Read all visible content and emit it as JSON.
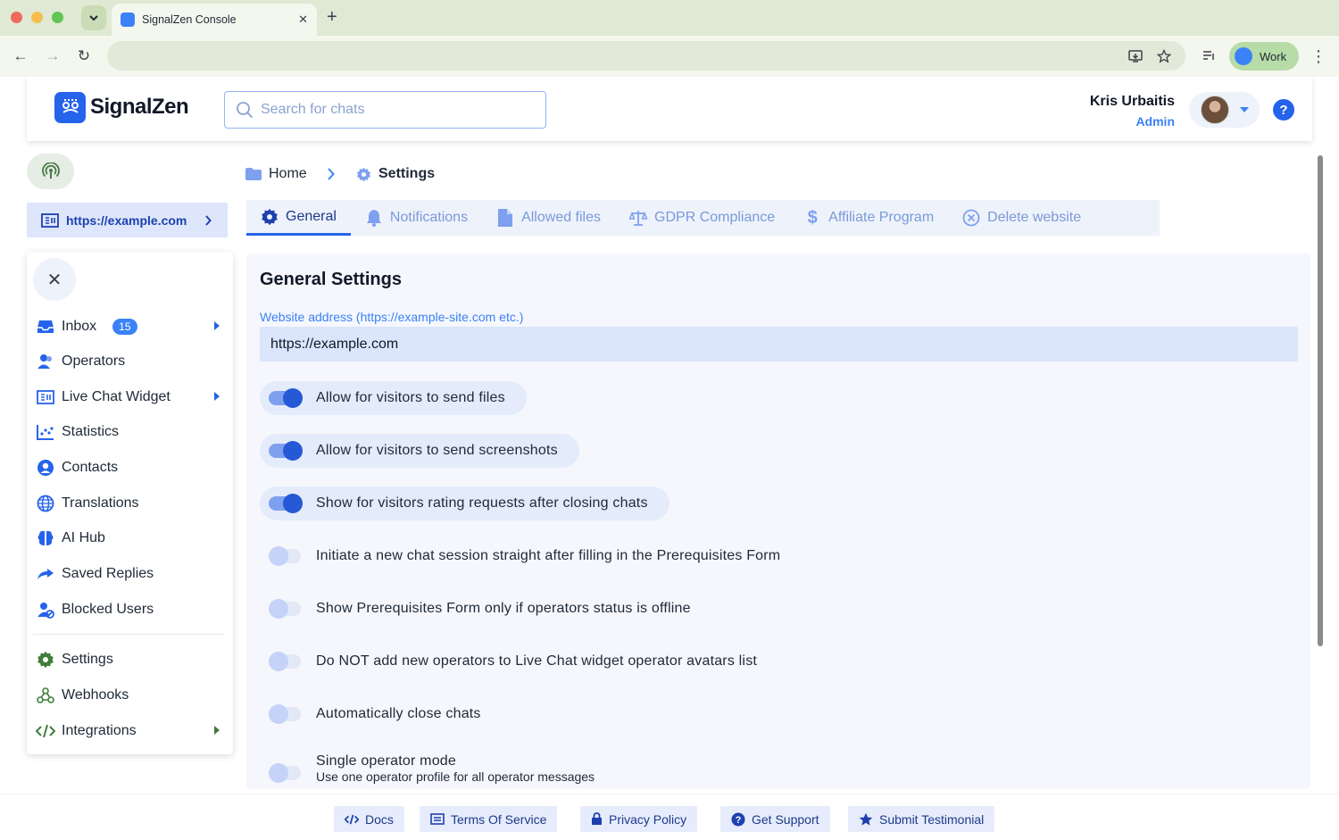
{
  "browser": {
    "tab_title": "SignalZen Console",
    "profile_label": "Work"
  },
  "header": {
    "logo_text": "SignalZen",
    "search_placeholder": "Search for chats",
    "user_name": "Kris Urbaitis",
    "user_role": "Admin",
    "help_label": "?"
  },
  "website_button": "https://example.com",
  "sidebar": {
    "items": [
      {
        "label": "Inbox",
        "badge": "15"
      },
      {
        "label": "Operators"
      },
      {
        "label": "Live Chat Widget"
      },
      {
        "label": "Statistics"
      },
      {
        "label": "Contacts"
      },
      {
        "label": "Translations"
      },
      {
        "label": "AI Hub"
      },
      {
        "label": "Saved Replies"
      },
      {
        "label": "Blocked Users"
      },
      {
        "label": "Settings"
      },
      {
        "label": "Webhooks"
      },
      {
        "label": "Integrations"
      }
    ]
  },
  "breadcrumb": {
    "home": "Home",
    "current": "Settings"
  },
  "tabs": [
    {
      "label": "General",
      "active": true
    },
    {
      "label": "Notifications"
    },
    {
      "label": "Allowed files"
    },
    {
      "label": "GDPR Compliance"
    },
    {
      "label": "Affiliate Program"
    },
    {
      "label": "Delete website"
    }
  ],
  "general": {
    "title": "General Settings",
    "website_label": "Website address (https://example-site.com etc.)",
    "website_value": "https://example.com",
    "toggles": [
      {
        "label": "Allow for visitors to send files",
        "on": true
      },
      {
        "label": "Allow for visitors to send screenshots",
        "on": true
      },
      {
        "label": "Show for visitors rating requests after closing chats",
        "on": true
      },
      {
        "label": "Initiate a new chat session straight after filling in the Prerequisites Form",
        "on": false
      },
      {
        "label": "Show Prerequisites Form only if operators status is offline",
        "on": false
      },
      {
        "label": "Do NOT add new operators to Live Chat widget operator avatars list",
        "on": false
      },
      {
        "label": "Automatically close chats",
        "on": false
      },
      {
        "label": "Single operator mode",
        "sub": "Use one operator profile for all operator messages",
        "on": false
      }
    ]
  },
  "footer": {
    "links": [
      "Docs",
      "Terms Of Service",
      "Privacy Policy",
      "Get Support",
      "Submit Testimonial"
    ]
  },
  "colors": {
    "accent": "#2563eb",
    "toggle_on": "#2559d6",
    "panel_bg": "#f5f7fd",
    "chrome_bg": "#dfe9d3"
  },
  "icons": {
    "sidebar": [
      "inbox-icon",
      "operators-icon",
      "widget-icon",
      "statistics-icon",
      "contacts-icon",
      "globe-icon",
      "brain-icon",
      "share-icon",
      "user-block-icon",
      "gear-icon",
      "webhook-icon",
      "code-icon"
    ],
    "tabs": [
      "gear-icon",
      "bell-icon",
      "file-icon",
      "scale-icon",
      "dollar-icon",
      "circle-x-icon"
    ],
    "footer": [
      "code-icon",
      "document-icon",
      "lock-icon",
      "help-circle-icon",
      "star-icon"
    ]
  }
}
